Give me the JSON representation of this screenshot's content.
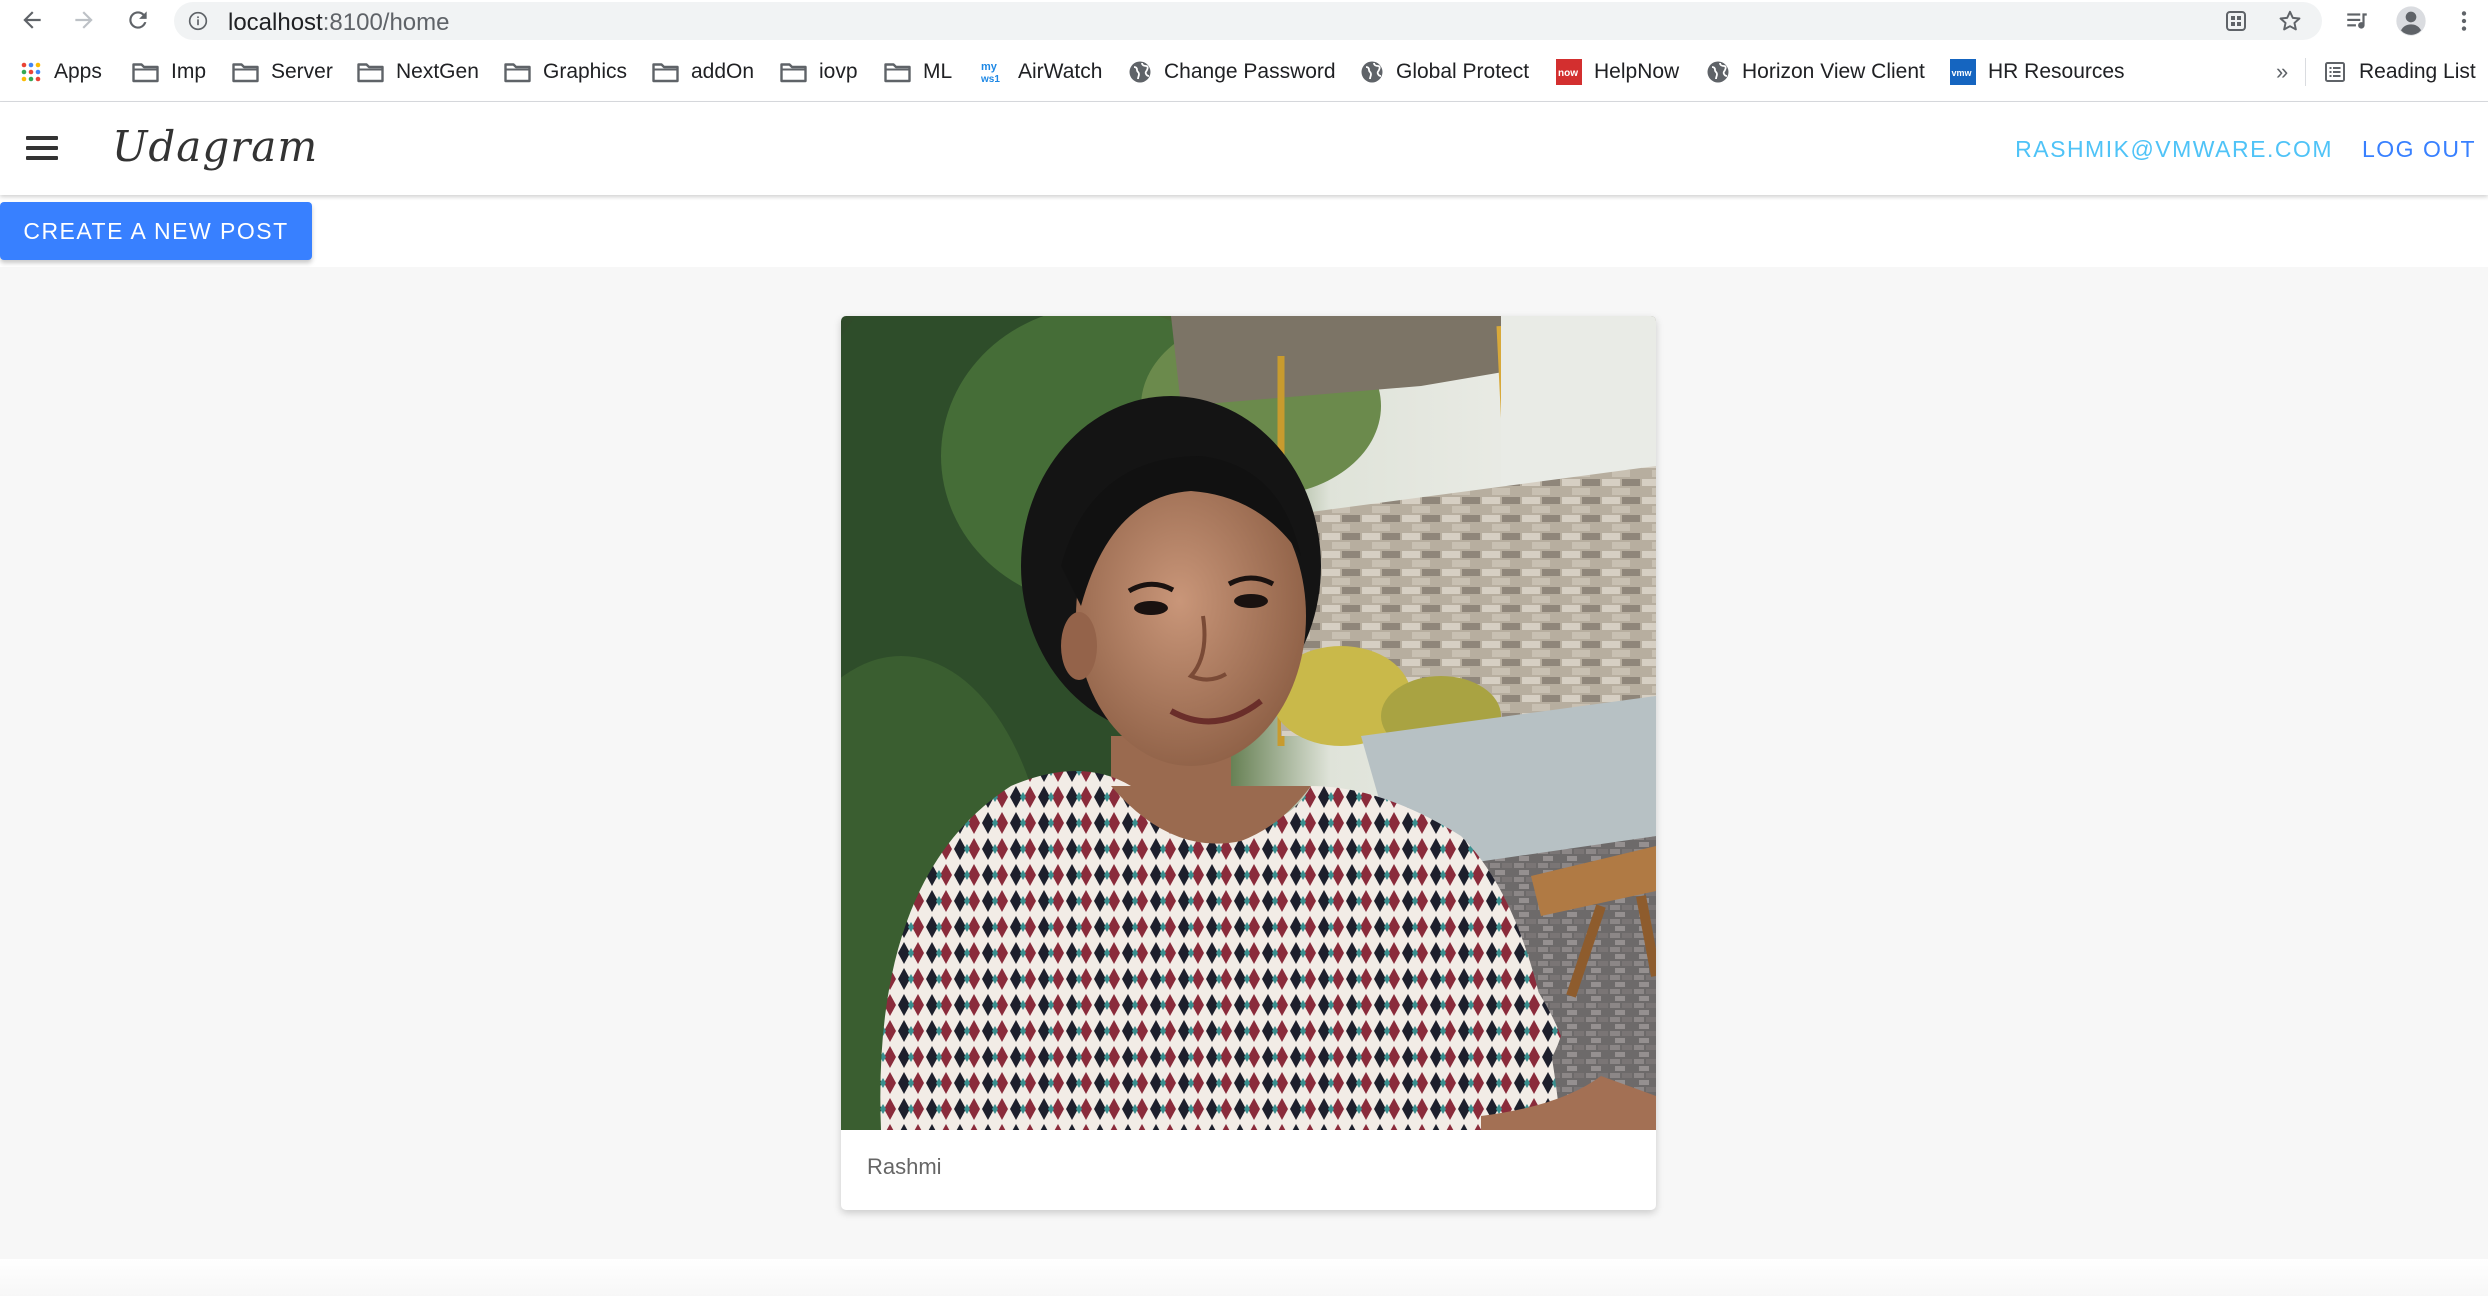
{
  "browser": {
    "url_host": "localhost",
    "url_rest": ":8100/home",
    "bookmarks": [
      {
        "label": "Apps",
        "icon": "apps-grid-icon"
      },
      {
        "label": "Imp",
        "icon": "folder-icon"
      },
      {
        "label": "Server",
        "icon": "folder-icon"
      },
      {
        "label": "NextGen",
        "icon": "folder-icon"
      },
      {
        "label": "Graphics",
        "icon": "folder-icon"
      },
      {
        "label": "addOn",
        "icon": "folder-icon"
      },
      {
        "label": "iovp",
        "icon": "folder-icon"
      },
      {
        "label": "ML",
        "icon": "folder-icon"
      },
      {
        "label": "AirWatch",
        "icon": "myws1-icon"
      },
      {
        "label": "Change Password",
        "icon": "globe-icon"
      },
      {
        "label": "Global Protect",
        "icon": "globe-icon"
      },
      {
        "label": "HelpNow",
        "icon": "now-icon"
      },
      {
        "label": "Horizon View Client",
        "icon": "globe-icon"
      },
      {
        "label": "HR Resources",
        "icon": "vmw-icon"
      }
    ],
    "overflow_label": "»",
    "reading_list": "Reading List"
  },
  "app": {
    "brand": "Udagram",
    "user_email": "rashmik@vmware.com",
    "logout_label": "Log out",
    "create_post_label": "Create a new post",
    "accent": "#3880ff",
    "email_color": "#4fc3f7"
  },
  "feed": {
    "items": [
      {
        "caption": "Rashmi"
      }
    ]
  }
}
